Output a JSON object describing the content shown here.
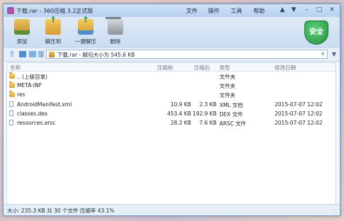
{
  "window": {
    "title": "下载.rar - 360压缩 3.2正式版",
    "menus": [
      "文件",
      "操作",
      "工具",
      "帮助"
    ],
    "title_icons": [
      "shirt-icon",
      "menu-icon"
    ],
    "window_buttons": [
      "minimize-icon",
      "maximize-icon",
      "close-icon"
    ]
  },
  "toolbar": {
    "add_label": "添加",
    "extract_to_label": "解压到",
    "one_click_label": "一键解压",
    "delete_label": "删除",
    "security_label": "安全"
  },
  "addressbar": {
    "path": "下载.rar - 解包大小为 545.6 KB"
  },
  "columns": {
    "name": "名称",
    "compressed": "压缩前",
    "size": "压缩后",
    "type": "类型",
    "modified": "修改日期"
  },
  "files": [
    {
      "icon": "folder",
      "name": ".. (上级目录)",
      "compressed": "",
      "size": "",
      "type": "文件夹",
      "modified": ""
    },
    {
      "icon": "folder",
      "name": "META-INF",
      "compressed": "",
      "size": "",
      "type": "文件夹",
      "modified": ""
    },
    {
      "icon": "folder",
      "name": "res",
      "compressed": "",
      "size": "",
      "type": "文件夹",
      "modified": ""
    },
    {
      "icon": "doc",
      "name": "AndroidManifest.xml",
      "compressed": "10.9 KB",
      "size": "2.3 KB",
      "type": "XML 文档",
      "modified": "2015-07-07 12:02"
    },
    {
      "icon": "doc",
      "name": "classes.dex",
      "compressed": "453.4 KB",
      "size": "192.9 KB",
      "type": "DEX 文件",
      "modified": "2015-07-07 12:02"
    },
    {
      "icon": "doc",
      "name": "resources.arsc",
      "compressed": "28.2 KB",
      "size": "7.6 KB",
      "type": "ARSC 文件",
      "modified": "2015-07-07 12:02"
    }
  ],
  "status": {
    "text": "大小: 235.3 KB 共 30 个文件 压缩率 43.1%"
  },
  "colors": {
    "titlebar": "#b7d2ef",
    "shield": "#1f8f3a",
    "folder": "#d8a33a"
  }
}
